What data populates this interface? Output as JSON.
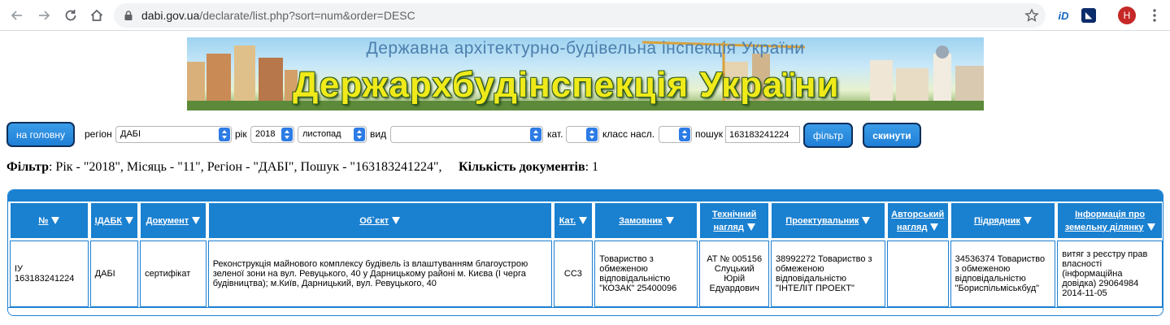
{
  "browser": {
    "url_host": "dabi.gov.ua",
    "url_rest": "/declarate/list.php?sort=num&order=DESC",
    "avatar_letter": "Н",
    "ext_id_label": "iD"
  },
  "banner": {
    "subtitle": "Державна архітектурно-будівельна інспекція України",
    "title": "Держархбудінспекція України"
  },
  "filters": {
    "home_button": "на головну",
    "region_label": "регіон",
    "region_value": "ДАБІ",
    "year_label": "рік",
    "year_value": "2018",
    "month_value": "листопад",
    "type_label": "вид",
    "type_value": "",
    "cat_label": "кат.",
    "cat_value": "",
    "class_label": "класс насл.",
    "class_value": "",
    "search_label": "пошук",
    "search_value": "163183241224",
    "filter_button": "фільтр",
    "reset_button": "скинути"
  },
  "summary": {
    "filter_label": "Фільтр",
    "filter_text": ": Рік - \"2018\", Місяць - \"11\", Регіон - \"ДАБІ\", Пошук - \"163183241224\",",
    "count_label": "Кількість документів",
    "count_value": ": 1"
  },
  "table": {
    "headers": [
      "№",
      "ІДАБК",
      "Документ",
      "Об`єкт",
      "Кат.",
      "Замовник",
      "Технічний нагляд",
      "Проектувальник",
      "Авторський нагляд",
      "Підрядник",
      "Інформація про земельну ділянку"
    ],
    "rows": [
      [
        "ІУ 163183241224",
        "ДАБІ",
        "сертифікат",
        "Реконструкція майнового комплексу будівель із влаштуванням благоустрою зеленої зони на вул. Ревуцького, 40 у Дарницькому районі м. Києва (I черга будівництва); м.Київ, Дарницький, вул. Ревуцького, 40",
        "СС3",
        "Товариство з обмеженою відповідальністю \"КОЗАК\" 25400096",
        "АТ № 005156 Слуцький Юрій Едуардович",
        "38992272 Товариство з обмеженою відповідальністю \"ІНТЕЛІТ ПРОЕКТ\"",
        "",
        "34536374 Товариство з обмеженою відповідальністю \"Бориспільміськбуд\"",
        "витяг з реєстру прав власності (інформаційна довідка) 29064984 2014-11-05"
      ]
    ]
  }
}
